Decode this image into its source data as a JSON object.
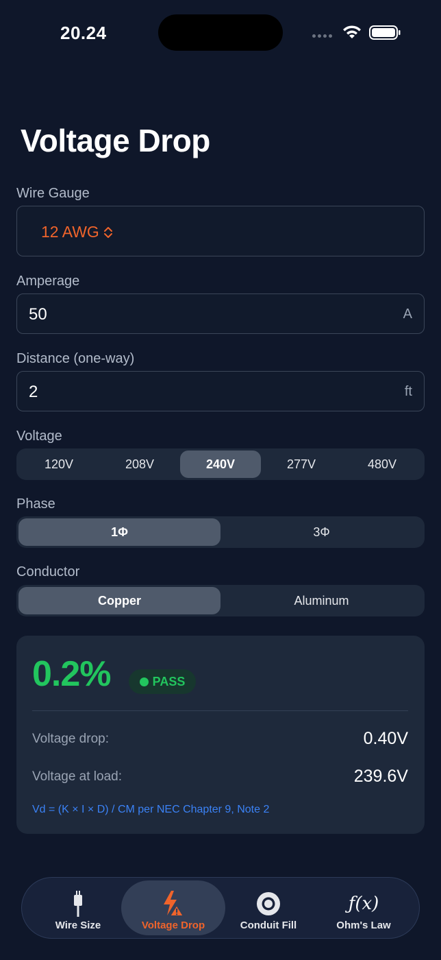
{
  "status_bar": {
    "time": "20.24"
  },
  "page": {
    "title": "Voltage Drop"
  },
  "wire_gauge": {
    "label": "Wire Gauge",
    "value": "12 AWG"
  },
  "amperage": {
    "label": "Amperage",
    "value": "50",
    "unit": "A"
  },
  "distance": {
    "label": "Distance (one-way)",
    "value": "2",
    "unit": "ft"
  },
  "voltage": {
    "label": "Voltage",
    "options": [
      "120V",
      "208V",
      "240V",
      "277V",
      "480V"
    ],
    "selected": "240V"
  },
  "phase": {
    "label": "Phase",
    "options": [
      "1Φ",
      "3Φ"
    ],
    "selected": "1Φ"
  },
  "conductor": {
    "label": "Conductor",
    "options": [
      "Copper",
      "Aluminum"
    ],
    "selected": "Copper"
  },
  "result": {
    "percent": "0.2%",
    "status": "PASS",
    "rows": [
      {
        "label": "Voltage drop:",
        "value": "0.40V"
      },
      {
        "label": "Voltage at load:",
        "value": "239.6V"
      }
    ],
    "formula": "Vd = (K × I × D) / CM per NEC Chapter 9, Note 2"
  },
  "tabs": [
    {
      "label": "Wire Size",
      "icon": "wire-icon"
    },
    {
      "label": "Voltage Drop",
      "icon": "lightning-warning-icon",
      "active": true
    },
    {
      "label": "Conduit Fill",
      "icon": "circle-target-icon"
    },
    {
      "label": "Ohm's Law",
      "icon": "function-icon",
      "glyph": "ƒ(x)"
    }
  ],
  "colors": {
    "background": "#0f172a",
    "accent": "#f0642b",
    "pass": "#22c55e",
    "link": "#3b82f6",
    "card": "#1e293b"
  }
}
